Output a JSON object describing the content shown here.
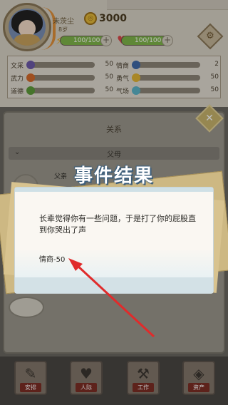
{
  "player": {
    "name": "未茨尘",
    "age": "8岁",
    "coins": "3000",
    "energy": "100/100",
    "energy_fraction": 1.0,
    "health": "100/100",
    "health_fraction": 1.0
  },
  "attributes": [
    {
      "label": "文采",
      "value": "50",
      "color": "#6d5aa8"
    },
    {
      "label": "情商",
      "value": "2",
      "color": "#3f6aa8"
    },
    {
      "label": "武力",
      "value": "50",
      "color": "#d56a2b"
    },
    {
      "label": "勇气",
      "value": "50",
      "color": "#e2b434"
    },
    {
      "label": "道德",
      "value": "50",
      "color": "#5e9b3a"
    },
    {
      "label": "气场",
      "value": "50",
      "color": "#5cb5c9"
    }
  ],
  "section": {
    "title": "关系",
    "subsection": "父母",
    "relative_name": "父亲"
  },
  "modal": {
    "title": "事件结果",
    "text": "长辈觉得你有一些问题，于是打了你的屁股直到你哭出了声",
    "effect": "情商-50"
  },
  "nav": [
    {
      "label": "安排",
      "icon": "✎"
    },
    {
      "label": "人际",
      "icon": "♥"
    },
    {
      "label": "工作",
      "icon": "⚒"
    },
    {
      "label": "资产",
      "icon": "◈"
    }
  ],
  "colors": {
    "arrow": "#e02b2b",
    "title_outline": "#3d5f7c"
  }
}
